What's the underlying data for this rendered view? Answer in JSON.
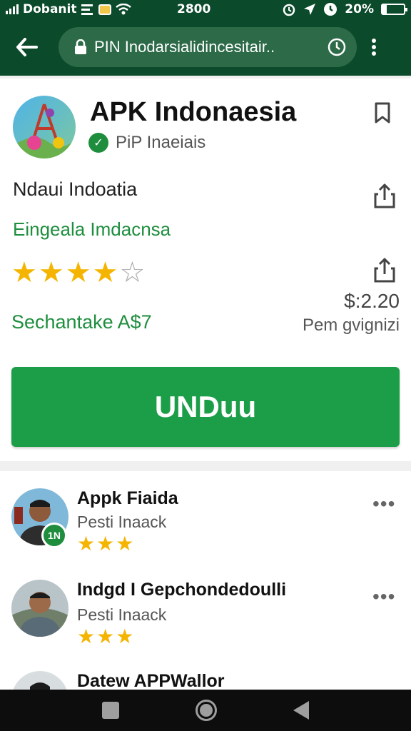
{
  "status_bar": {
    "carrier": "Dobanit",
    "time": "2800",
    "battery": "20%",
    "battery_level": 0.2,
    "icons": [
      "signal-icon",
      "menu-lines-icon",
      "notification-icon",
      "wifi-icon",
      "alarm-icon",
      "location-icon",
      "clock-icon",
      "battery-icon"
    ]
  },
  "browser": {
    "url": "PIN Inodarsialidincesitair..",
    "icons": [
      "back-arrow-icon",
      "lock-icon",
      "history-icon",
      "more-vert-icon"
    ]
  },
  "app": {
    "title": "APK Indonaesia",
    "developer": "PiP Inaeiais",
    "subtitle": "Ndaui Indoatia",
    "category": "Eingeala Imdacnsa",
    "rating": 4,
    "rating_max": 5,
    "price": "$:2.20",
    "promo": "Sechantake A$7",
    "price_note": "Pem gvignizi",
    "install_label": "UNDuu",
    "colors": {
      "brand_dark": "#0b4a2a",
      "accent_green": "#1e8e3e",
      "install_green": "#1c9e49",
      "star": "#f4b400"
    }
  },
  "reviews": [
    {
      "name": "Appk Fiaida",
      "meta": "Pesti Inaack",
      "stars": 3,
      "badge": "1N"
    },
    {
      "name": "Indgd I Gepchondedoulli",
      "meta": "Pesti Inaack",
      "stars": 3
    },
    {
      "name": "Datew APPWallor"
    }
  ],
  "nav": {
    "icons": [
      "recents-icon",
      "home-icon",
      "back-icon"
    ]
  }
}
